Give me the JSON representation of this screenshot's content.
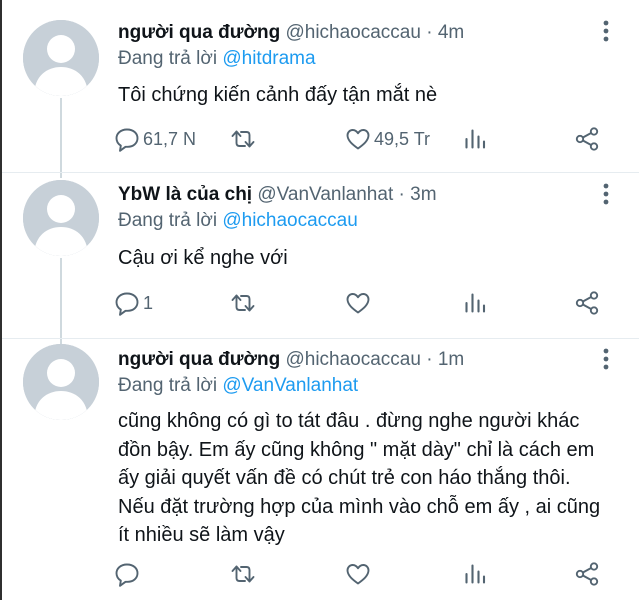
{
  "tweets": [
    {
      "name": "người qua đường",
      "handle": "@hichaocaccau",
      "dot": "·",
      "time": "4m",
      "reply_prefix": "Đang trả lời",
      "reply_to": "@hitdrama",
      "text": "Tôi chứng kiến cảnh đấy tận mắt nè",
      "actions": {
        "reply_count": "61,7 N",
        "retweet_count": "",
        "like_count": "49,5 Tr"
      }
    },
    {
      "name": "YbW là của chị",
      "handle": "@VanVanlanhat",
      "dot": "·",
      "time": "3m",
      "reply_prefix": "Đang trả lời",
      "reply_to": "@hichaocaccau",
      "text": "Cậu ơi kể nghe với",
      "actions": {
        "reply_count": "1",
        "retweet_count": "",
        "like_count": ""
      }
    },
    {
      "name": "người qua đường",
      "handle": "@hichaocaccau",
      "dot": "·",
      "time": "1m",
      "reply_prefix": "Đang trả lời",
      "reply_to": "@VanVanlanhat",
      "text": "cũng không có gì to tát đâu . đừng nghe người khác đồn bậy. Em ấy cũng không \" mặt dày\" chỉ là cách em ấy giải quyết vấn đề có chút trẻ con háo thắng thôi. Nếu đặt trường hợp của mình vào chỗ em ấy , ai cũng ít nhiều sẽ làm vậy",
      "actions": {
        "reply_count": "",
        "retweet_count": "",
        "like_count": ""
      }
    }
  ],
  "colors": {
    "text_primary": "#0f1419",
    "text_secondary": "#536471",
    "mention": "#1d9bf0",
    "avatar_bg": "#c7d0d8",
    "avatar_fg": "#ffffff",
    "thread_line": "#cfd9de"
  },
  "icons": [
    "more-vertical-icon",
    "reply-icon",
    "retweet-icon",
    "like-icon",
    "analytics-icon",
    "share-icon"
  ]
}
